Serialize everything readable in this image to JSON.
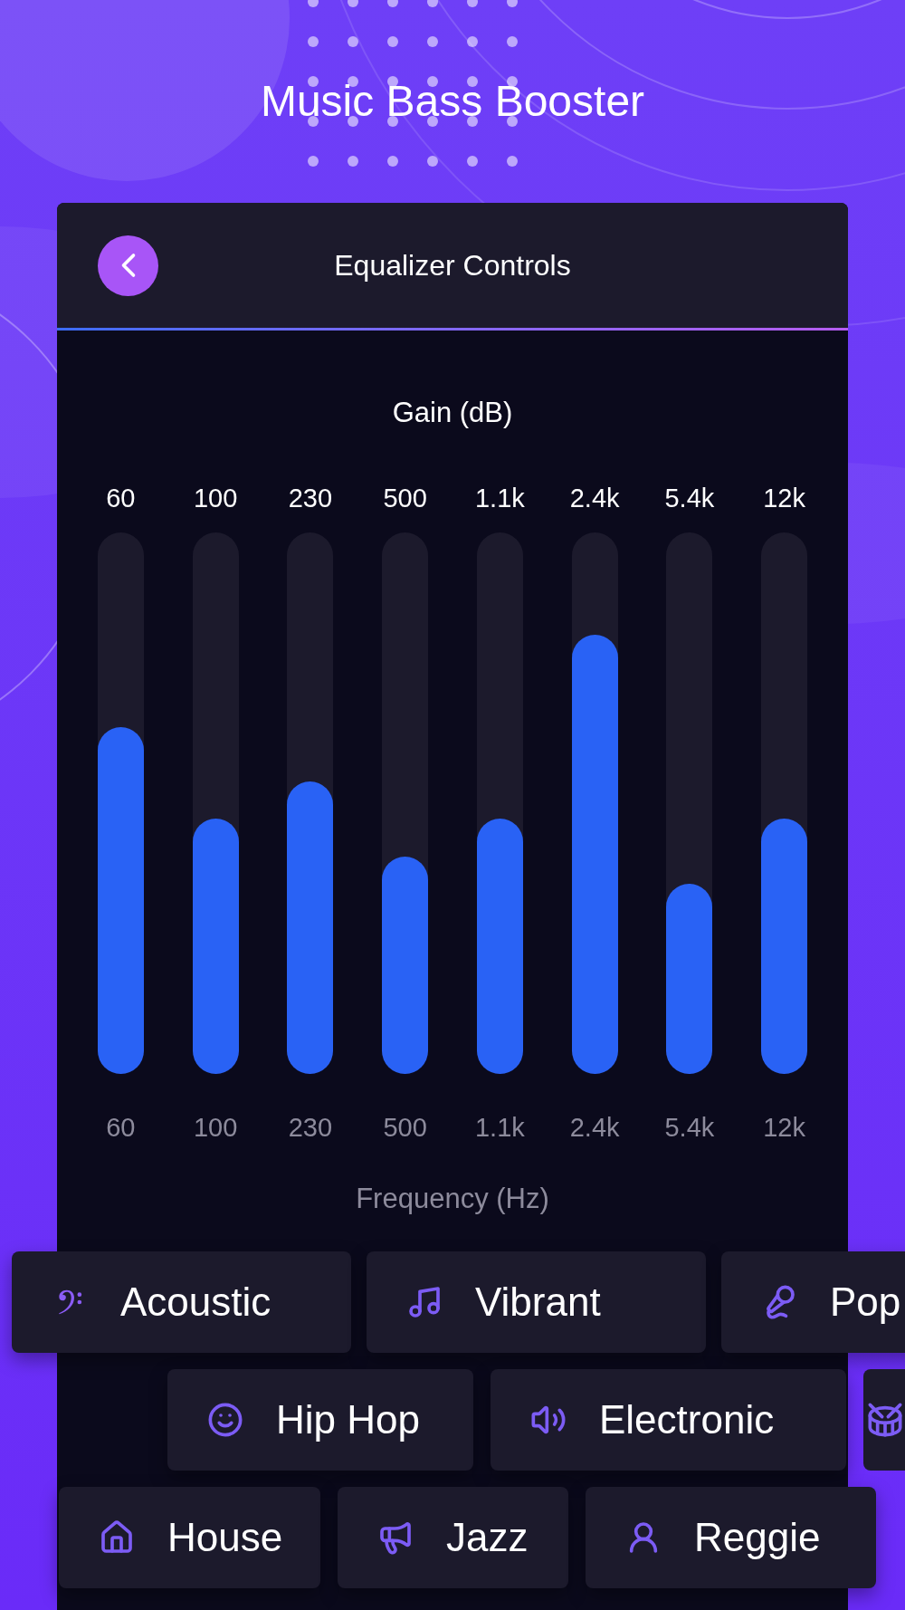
{
  "app_title": "Music Bass Booster",
  "header": {
    "title": "Equalizer Controls"
  },
  "equalizer": {
    "gain_label": "Gain (dB)",
    "frequency_label": "Frequency (Hz)",
    "bands": [
      {
        "top_label": "60",
        "bottom_label": "60",
        "level": 0.64
      },
      {
        "top_label": "100",
        "bottom_label": "100",
        "level": 0.47
      },
      {
        "top_label": "230",
        "bottom_label": "230",
        "level": 0.54
      },
      {
        "top_label": "500",
        "bottom_label": "500",
        "level": 0.4
      },
      {
        "top_label": "1.1k",
        "bottom_label": "1.1k",
        "level": 0.47
      },
      {
        "top_label": "2.4k",
        "bottom_label": "2.4k",
        "level": 0.81
      },
      {
        "top_label": "5.4k",
        "bottom_label": "5.4k",
        "level": 0.35
      },
      {
        "top_label": "12k",
        "bottom_label": "12k",
        "level": 0.47
      }
    ]
  },
  "preset_rows": [
    {
      "presets": [
        {
          "kind": "labeled",
          "label": "Acoustic"
        },
        {
          "kind": "labeled",
          "label": "Vibrant"
        },
        {
          "kind": "labeled",
          "label": "Pop"
        }
      ]
    },
    {
      "presets": [
        {
          "kind": "labeled",
          "label": "Hip Hop"
        },
        {
          "kind": "labeled",
          "label": "Electronic"
        },
        {
          "kind": "icon_only"
        }
      ]
    },
    {
      "presets": [
        {
          "kind": "labeled",
          "label": "House"
        },
        {
          "kind": "labeled",
          "label": "Jazz"
        },
        {
          "kind": "labeled",
          "label": "Reggie"
        }
      ]
    }
  ]
}
